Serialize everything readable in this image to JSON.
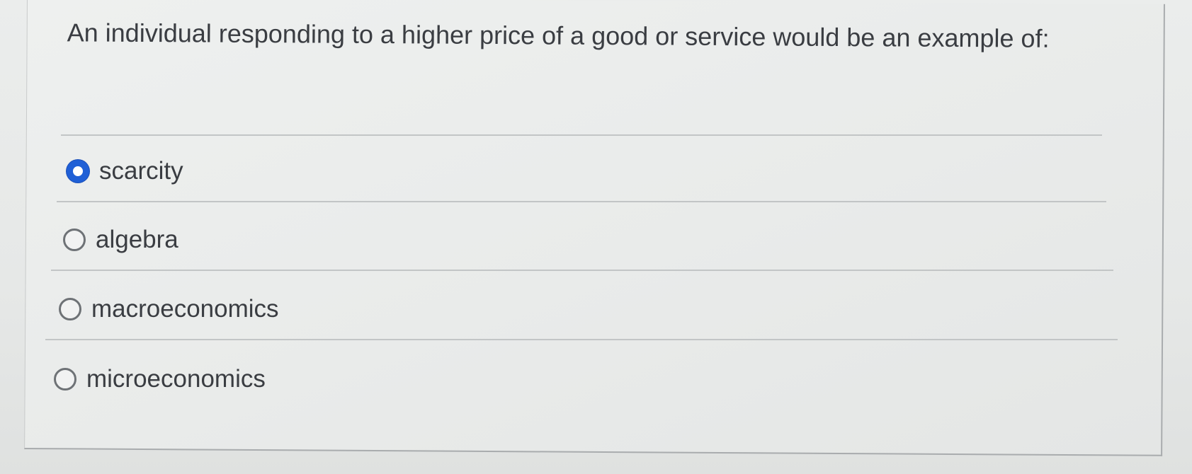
{
  "question": {
    "text": "An individual responding to a higher price of a good or service would be an example of:"
  },
  "options": [
    {
      "label": "scarcity",
      "selected": true
    },
    {
      "label": "algebra",
      "selected": false
    },
    {
      "label": "macroeconomics",
      "selected": false
    },
    {
      "label": "microeconomics",
      "selected": false
    }
  ],
  "colors": {
    "selected_radio": "#1f5fd6",
    "text": "#3a3d42",
    "background": "#e9ebea"
  }
}
